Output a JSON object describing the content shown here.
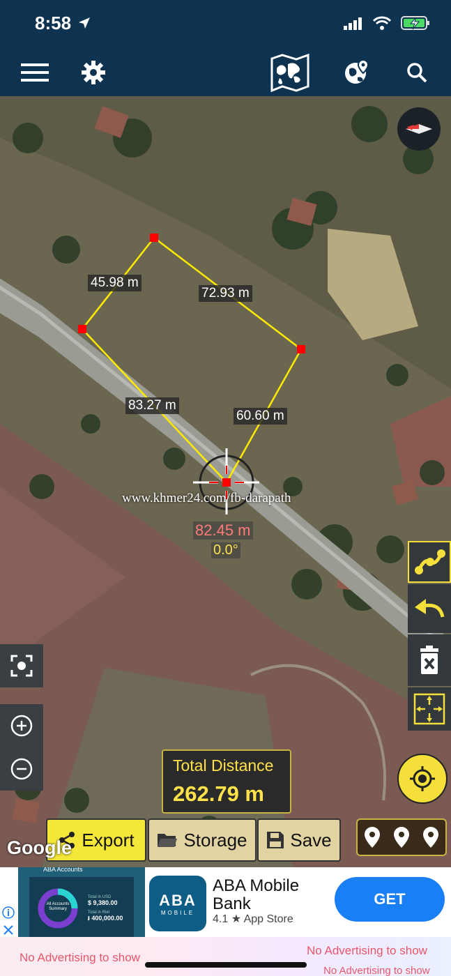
{
  "status_bar": {
    "time": "8:58"
  },
  "toolbar": {
    "icons": [
      "menu-icon",
      "settings-icon",
      "map-layers-icon",
      "globe-icon",
      "search-icon"
    ]
  },
  "map": {
    "measurements": {
      "segment_1": "45.98 m",
      "segment_2": "72.93 m",
      "segment_3": "83.27 m",
      "segment_4": "60.60 m"
    },
    "watermark": "www.khmer24.com/fb-darapath",
    "live_distance": "82.45 m",
    "live_angle": "0.0°",
    "attribution": "Google"
  },
  "total": {
    "label": "Total Distance",
    "value": "262.79 m"
  },
  "bottom_bar": {
    "export_label": "Export",
    "storage_label": "Storage",
    "save_label": "Save"
  },
  "ad": {
    "thumb_header": "ABA Accounts",
    "thumb_summary": "All Accounts Summary",
    "thumb_usd_label": "Total in USD",
    "thumb_usd": "$ 9,380.00",
    "thumb_khr_label": "Total in Riel",
    "thumb_khr": "៛ 400,000.00",
    "logo_big": "ABA",
    "logo_small": "MOBILE",
    "title": "ABA Mobile Bank",
    "rating": "4.1 ★ App Store",
    "cta": "GET"
  },
  "no_ads": {
    "left": "No Advertising to show",
    "right": "No Advertising to show",
    "right_bottom": "No Advertising to show"
  },
  "colors": {
    "header": "#0d3350",
    "accent_yellow": "#f5df3a",
    "vertex_red": "#ff0000",
    "ad_button": "#1a7ff5"
  }
}
